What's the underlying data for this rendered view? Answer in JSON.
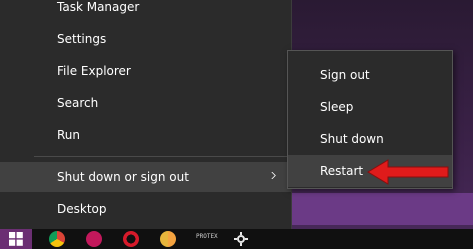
{
  "menu": {
    "items": [
      {
        "label": "Task Manager"
      },
      {
        "label": "Settings"
      },
      {
        "label": "File Explorer"
      },
      {
        "label": "Search"
      },
      {
        "label": "Run"
      },
      {
        "label": "Shut down or sign out"
      },
      {
        "label": "Desktop"
      }
    ]
  },
  "submenu": {
    "items": [
      {
        "label": "Sign out"
      },
      {
        "label": "Sleep"
      },
      {
        "label": "Shut down"
      },
      {
        "label": "Restart"
      }
    ]
  },
  "taskbar": {
    "start_icon": "windows-logo-icon",
    "pinned_icons": [
      "chrome-icon",
      "browser-icon",
      "opera-icon",
      "chrome-canary-icon"
    ],
    "app_label": "PROTEX"
  },
  "annotation": {
    "arrow_color": "#e01b1b",
    "points_to": "Restart"
  },
  "colors": {
    "menu_bg": "#2b2b2b",
    "hover_bg": "#414141",
    "accent": "#6b2f73"
  }
}
